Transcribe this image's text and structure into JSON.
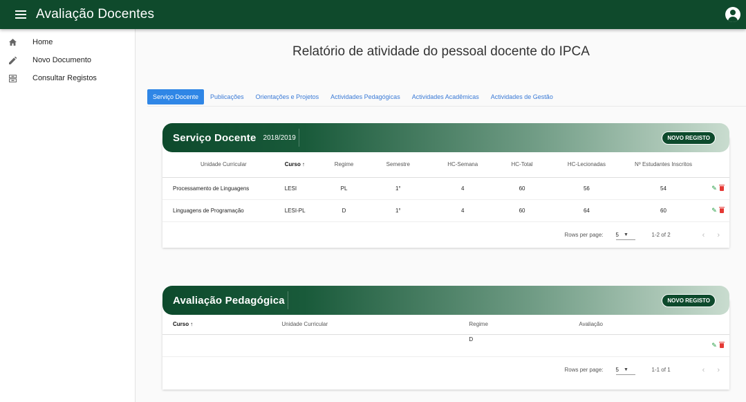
{
  "app": {
    "title": "Avaliação Docentes"
  },
  "sidebar": {
    "items": [
      {
        "label": "Home",
        "icon": "home-icon"
      },
      {
        "label": "Novo Documento",
        "icon": "pencil-icon"
      },
      {
        "label": "Consultar Registos",
        "icon": "inbox-icon"
      }
    ]
  },
  "main": {
    "title": "Relatório de atividade do pessoal docente do IPCA",
    "tabs": [
      {
        "label": "Serviço Docente",
        "active": true
      },
      {
        "label": "Publicações"
      },
      {
        "label": "Orientações e Projetos"
      },
      {
        "label": "Actividades Pedagógicas"
      },
      {
        "label": "Actividades Acadêmicas"
      },
      {
        "label": "Actividades de Gestão"
      }
    ]
  },
  "servico": {
    "title": "Serviço Docente",
    "year": "2018/2019",
    "button": "NOVO REGISTO",
    "columns": [
      "Unidade Curricular",
      "Curso",
      "Regime",
      "Semestre",
      "HC-Semana",
      "HC-Total",
      "HC-Lecionadas",
      "Nº Estudantes Inscritos"
    ],
    "sort_arrow": "↑",
    "rows": [
      [
        "Processamento de Linguagens",
        "LESI",
        "PL",
        "1°",
        "4",
        "60",
        "56",
        "54"
      ],
      [
        "Linguagens de Programação",
        "LESI-PL",
        "D",
        "1°",
        "4",
        "60",
        "64",
        "60"
      ]
    ],
    "rows_per_page_label": "Rows per page:",
    "rows_per_page": "5",
    "range": "1-2 of 2"
  },
  "avaliacao": {
    "title": "Avaliação Pedagógica",
    "button": "NOVO REGISTO",
    "columns": [
      "Curso",
      "Unidade Curricular",
      "Regime",
      "Avaliação"
    ],
    "sort_arrow": "↑",
    "rows": [
      [
        "",
        "",
        "D",
        ""
      ]
    ],
    "rows_per_page_label": "Rows per page:",
    "rows_per_page": "5",
    "range": "1-1 of 1"
  },
  "colors": {
    "primary": "#0f4a2c",
    "tab_active": "#2f86e6",
    "edit": "#1f9a3d",
    "delete": "#e53935"
  }
}
